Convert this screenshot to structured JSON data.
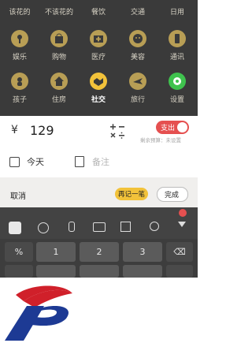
{
  "categories_row0": [
    "该花的",
    "不该花的",
    "餐饮",
    "交通",
    "日用"
  ],
  "categories_row1": [
    "娱乐",
    "购物",
    "医疗",
    "美容",
    "通讯"
  ],
  "categories_row2": [
    "孩子",
    "住房",
    "社交",
    "旅行",
    "设置"
  ],
  "amount": {
    "currency": "¥",
    "value": "129",
    "calc_icon": "calculator-icon",
    "toggle_label": "支出",
    "remaining": "剩余预算：未设置"
  },
  "meta": {
    "date_label": "今天",
    "note_placeholder": "备注"
  },
  "actions": {
    "cancel": "取消",
    "again": "再记一笔",
    "done": "完成"
  },
  "keyboard": {
    "keys_row1": [
      "%",
      "1",
      "2",
      "3"
    ],
    "delete_icon": "backspace-icon"
  },
  "colors": {
    "accent": "#f2c23a",
    "expense": "#e55050",
    "icon_gold": "#b89e55",
    "settings_green": "#3fc24e"
  }
}
